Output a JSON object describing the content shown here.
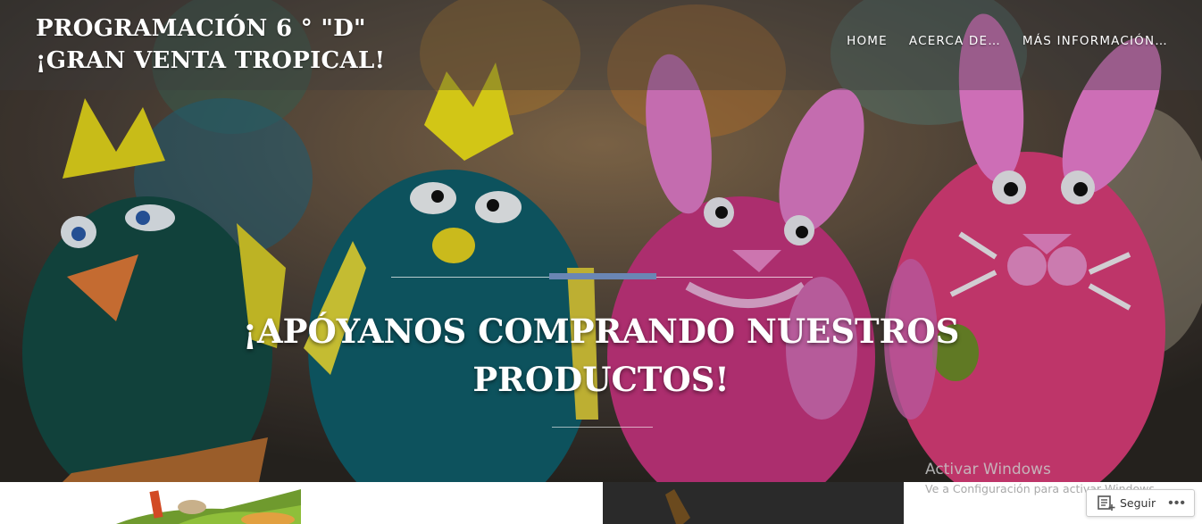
{
  "site": {
    "title_line1": "PROGRAMACIÓN 6 ° \"D\"",
    "title_line2": "¡GRAN VENTA TROPICAL!"
  },
  "nav": {
    "items": [
      {
        "label": "HOME"
      },
      {
        "label": "ACERCA DE…"
      },
      {
        "label": "MÁS INFORMACIÓN…"
      }
    ]
  },
  "hero": {
    "heading": "¡APÓYANOS COMPRANDO NUESTROS PRODUCTOS!",
    "accent_color": "#6a86b4",
    "image_subject": "easter-eggs-chicks-and-bunnies"
  },
  "watermark": {
    "title": "Activar Windows",
    "subtitle": "Ve a Configuración para activar Windows."
  },
  "follow_button": {
    "label": "Seguir",
    "more": "•••",
    "icon": "reader-follow-icon"
  }
}
